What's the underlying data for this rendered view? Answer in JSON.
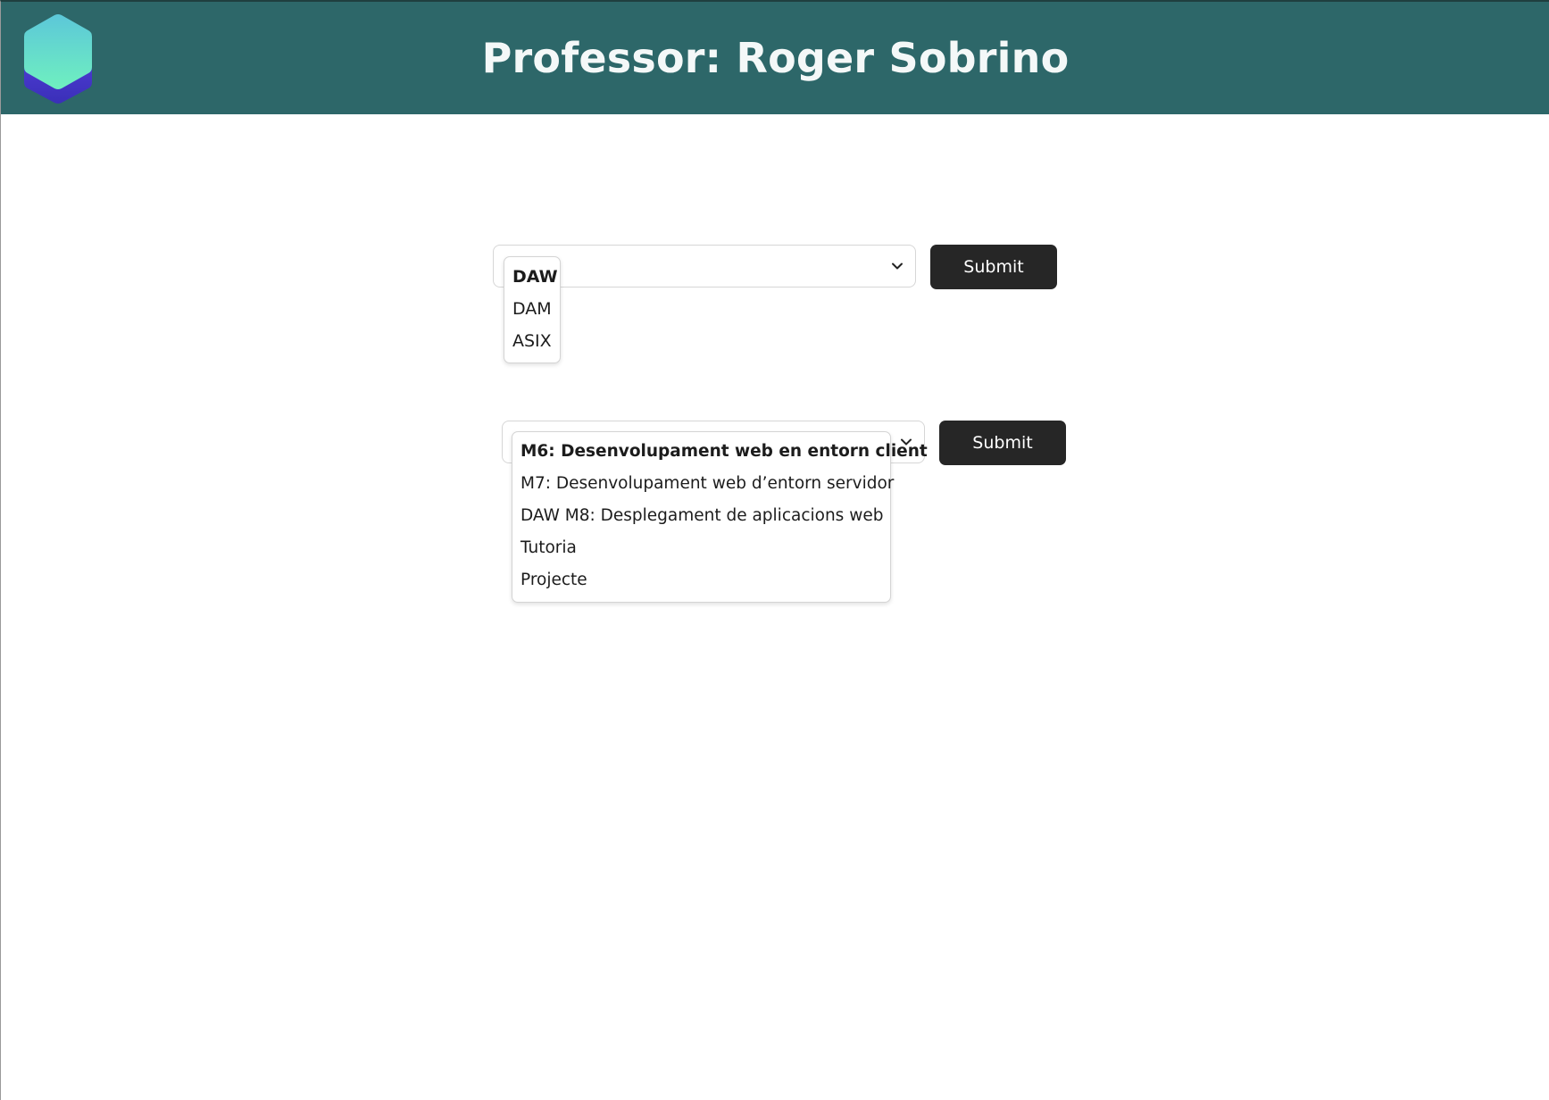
{
  "header": {
    "title": "Professor: Roger Sobrino",
    "background": "#2d6769"
  },
  "logo": {
    "icon": "hexagon-logo-icon",
    "gradient_top": "#6ee7c4",
    "gradient_bottom": "#4338ca"
  },
  "forms": [
    {
      "submit_label": "Submit",
      "options": [
        "DAW",
        "DAM",
        "ASIX"
      ],
      "selected_option": "DAW"
    },
    {
      "submit_label": "Submit",
      "options": [
        "M6: Desenvolupament web en entorn client",
        "M7: Desenvolupament web d’entorn servidor",
        "DAW M8: Desplegament de aplicacions web",
        "Tutoria",
        "Projecte"
      ],
      "selected_option": "M6: Desenvolupament web en entorn client"
    }
  ],
  "colors": {
    "button": "#262626",
    "button_text": "#ffffff",
    "title_text": "#f4f8f8"
  }
}
